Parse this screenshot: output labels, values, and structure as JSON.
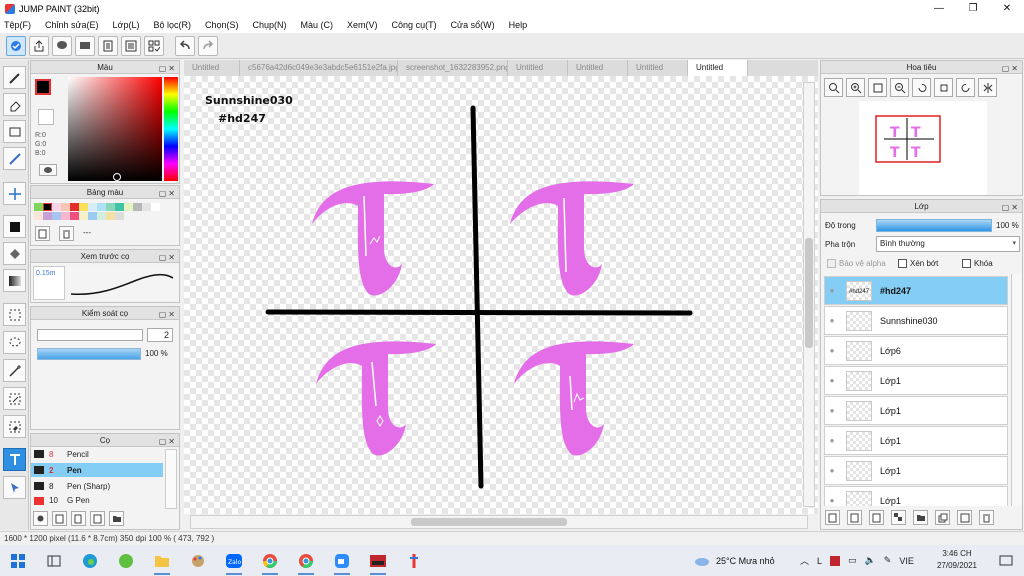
{
  "window": {
    "title": "JUMP PAINT (32bit)"
  },
  "menu": [
    "Tệp(F)",
    "Chỉnh sửa(E)",
    "Lớp(L)",
    "Bộ lọc(R)",
    "Chọn(S)",
    "Chụp(N)",
    "Màu (C)",
    "Xem(V)",
    "Công cụ(T)",
    "Cửa sổ(W)",
    "Help"
  ],
  "panels": {
    "color": {
      "title": "Màu",
      "r": "R:0",
      "g": "G:0",
      "b": "B:0"
    },
    "swatches": {
      "title": "Bảng màu",
      "selected_label": "---"
    },
    "brush_preview": {
      "title": "Xem trước cọ",
      "size": "0.15m"
    },
    "brush_control": {
      "title": "Kiểm soát cọ",
      "size_value": "2",
      "opacity_value": "100 %",
      "opacity_level": 1.0
    },
    "brushes": {
      "title": "Cọ",
      "items": [
        {
          "size": "8",
          "name": "Pencil"
        },
        {
          "size": "2",
          "name": "Pen"
        },
        {
          "size": "8",
          "name": "Pen (Sharp)"
        },
        {
          "size": "10",
          "name": "G Pen"
        }
      ]
    },
    "navigator": {
      "title": "Hoa tiêu"
    },
    "layers": {
      "title": "Lớp",
      "opacity_label": "Độ trong",
      "opacity_value": "100 %",
      "opacity_level": 1.0,
      "blend_label": "Pha trộn",
      "blend_value": "Bình thường",
      "protect_alpha": "Bảo vệ alpha",
      "clip": "Xén bớt",
      "lock": "Khóa",
      "items": [
        {
          "name": "#hd247",
          "thumb": "#hd247"
        },
        {
          "name": "Sunnshine030",
          "thumb": ""
        },
        {
          "name": "Lớp6",
          "thumb": ""
        },
        {
          "name": "Lớp1",
          "thumb": ""
        },
        {
          "name": "Lớp1",
          "thumb": ""
        },
        {
          "name": "Lớp1",
          "thumb": ""
        },
        {
          "name": "Lớp1",
          "thumb": ""
        },
        {
          "name": "Lớp1",
          "thumb": ""
        }
      ]
    }
  },
  "tabs": [
    "Untitled",
    "c5676a42d6c049e3e3abdc5e6151e2fa.jpg",
    "screenshot_1632283952.png",
    "Untitled",
    "Untitled",
    "Untitled",
    "Untitled"
  ],
  "canvas": {
    "text1": "Sunnshine030",
    "text2": "#hd247",
    "accent": "#e36ee8"
  },
  "status": "1600 * 1200 pixel   (11.6 * 8.7cm)   350 dpi   100 %   ( 473, 792 )",
  "taskbar": {
    "weather": "25°C  Mưa nhỏ",
    "lang": "VIE",
    "time": "3:46 CH",
    "date": "27/09/2021"
  }
}
